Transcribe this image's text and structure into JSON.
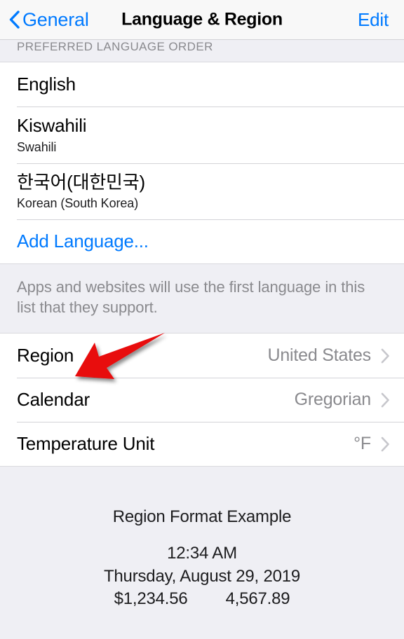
{
  "navbar": {
    "back_label": "General",
    "back_icon": "chevron-left-icon",
    "title": "Language & Region",
    "edit_label": "Edit",
    "accent_color": "#007aff"
  },
  "language_section": {
    "header": "PREFERRED LANGUAGE ORDER",
    "items": [
      {
        "title": "English",
        "subtitle": ""
      },
      {
        "title": "Kiswahili",
        "subtitle": "Swahili"
      },
      {
        "title": "한국어(대한민국)",
        "subtitle": "Korean (South Korea)"
      }
    ],
    "add_language_label": "Add Language...",
    "footer_note": "Apps and websites will use the first language in this list that they support."
  },
  "region_section": {
    "rows": [
      {
        "label": "Region",
        "value": "United States",
        "accessory": "chevron-right-icon"
      },
      {
        "label": "Calendar",
        "value": "Gregorian",
        "accessory": "chevron-right-icon"
      },
      {
        "label": "Temperature Unit",
        "value": "°F",
        "accessory": "chevron-right-icon"
      }
    ]
  },
  "region_format_example": {
    "title": "Region Format Example",
    "time": "12:34 AM",
    "date": "Thursday, August 29, 2019",
    "currency": "$1,234.56",
    "number": "4,567.89"
  },
  "annotation": {
    "type": "arrow",
    "color": "#e8070a",
    "points_to": "Region"
  }
}
